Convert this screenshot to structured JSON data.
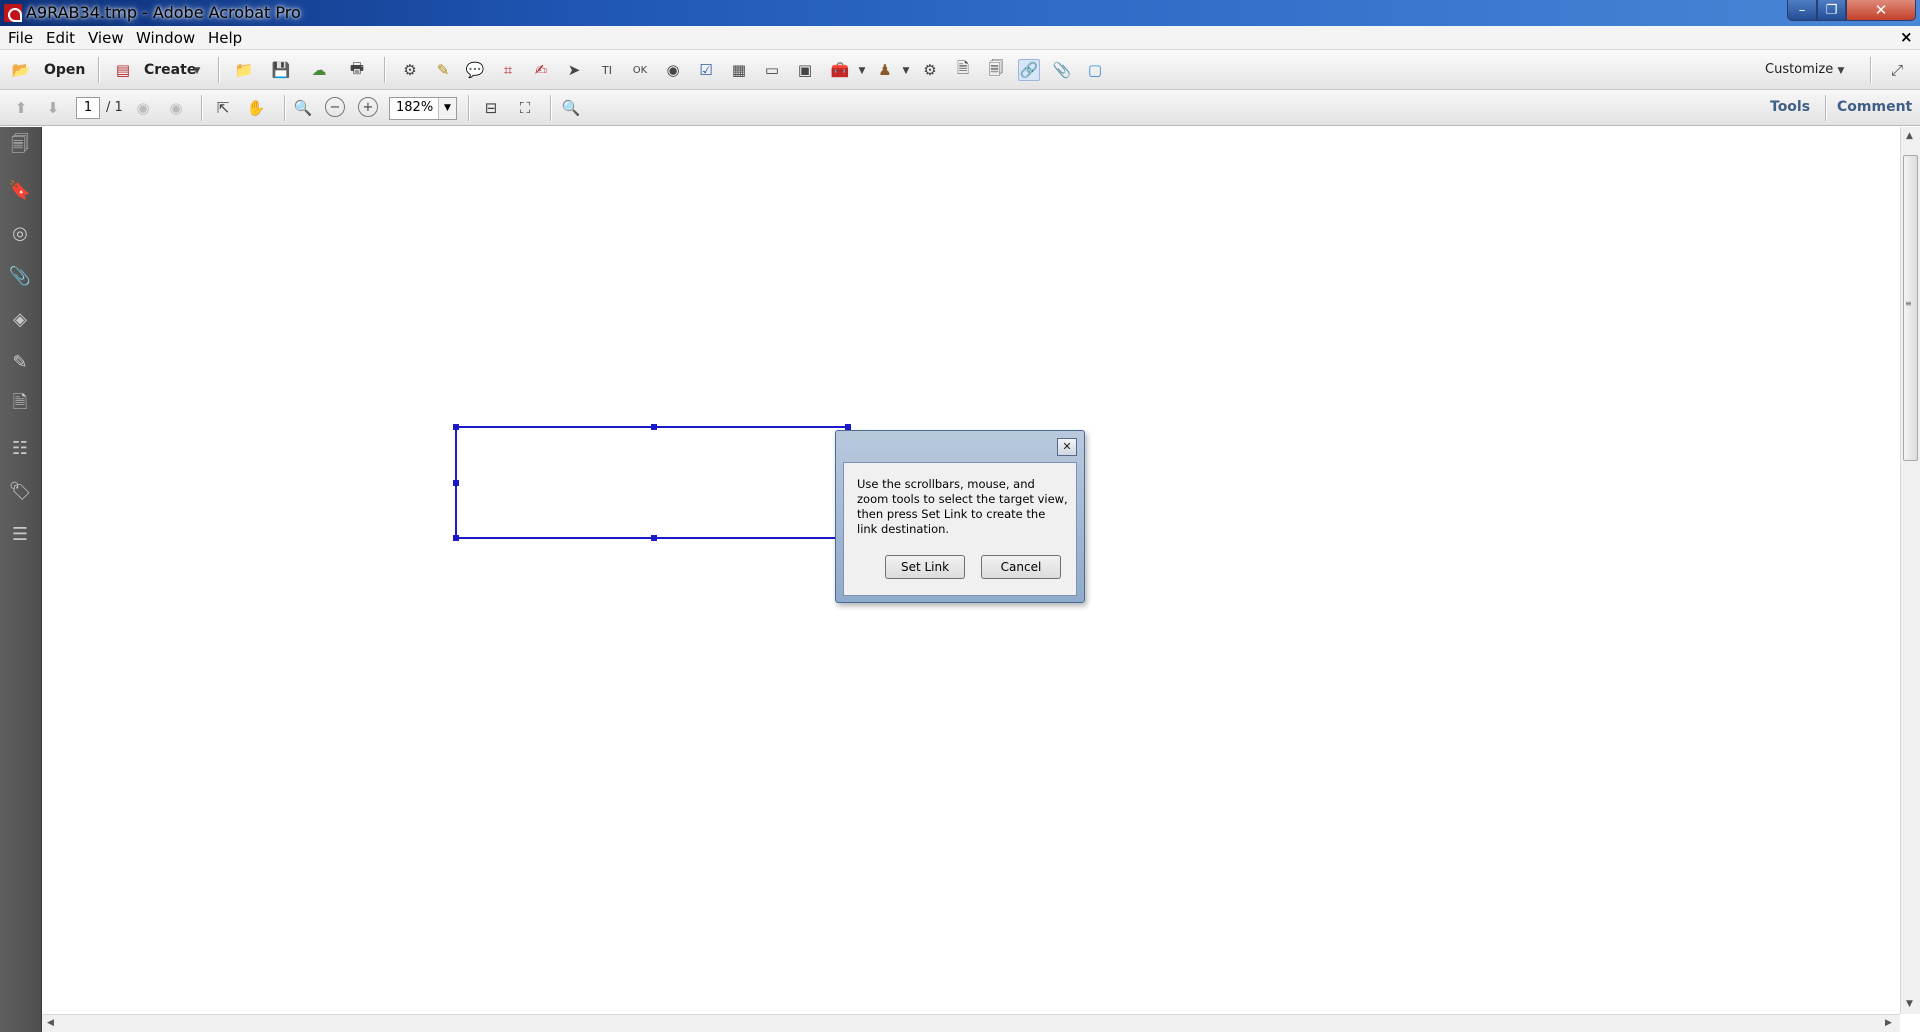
{
  "window": {
    "title": "A9RAB34.tmp - Adobe Acrobat Pro",
    "minimize": "–",
    "maximize": "❐",
    "close": "✕"
  },
  "menu": {
    "items": [
      "File",
      "Edit",
      "View",
      "Window",
      "Help"
    ],
    "doc_close": "×"
  },
  "toolbar": {
    "open_label": "Open",
    "create_label": "Create",
    "customize_label": "Customize"
  },
  "navbar": {
    "current_page": "1",
    "total_pages": "/ 1",
    "zoom": "182%",
    "tools_label": "Tools",
    "comment_label": "Comment"
  },
  "dialog": {
    "message": "Use the scrollbars, mouse, and zoom tools to select the target view, then press Set Link to create the link destination.",
    "set_link_label": "Set Link",
    "cancel_label": "Cancel",
    "close_glyph": "✕"
  }
}
